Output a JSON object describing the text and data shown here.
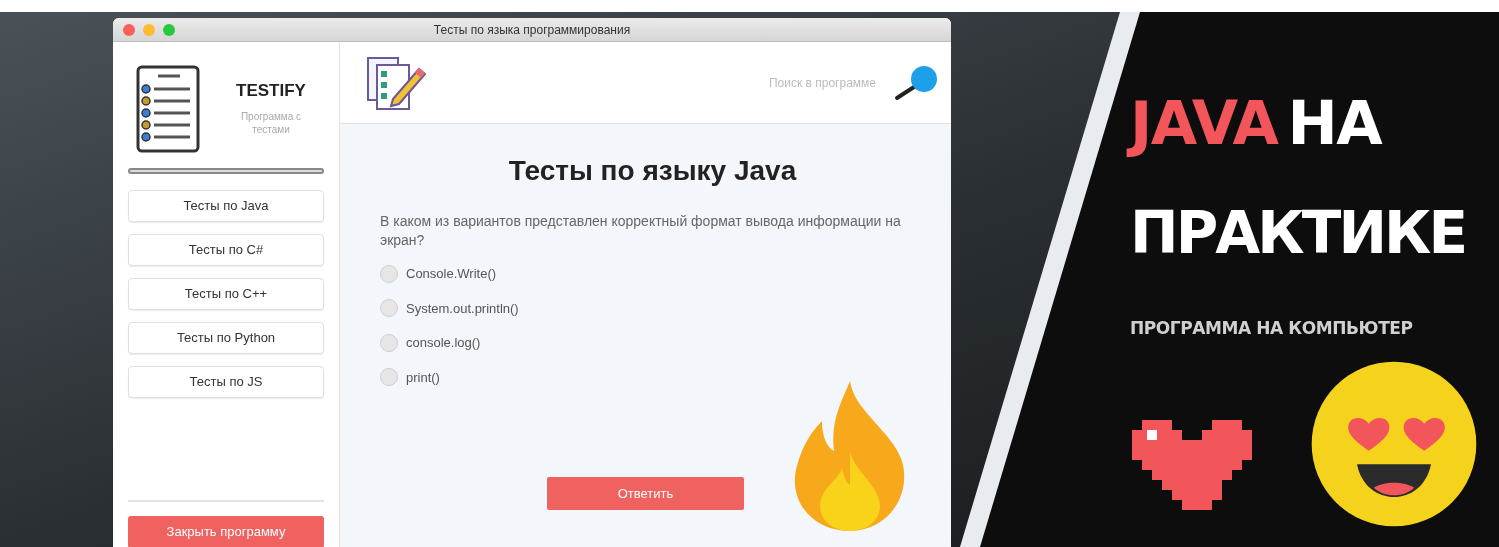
{
  "window": {
    "title": "Тесты по языка программирования"
  },
  "sidebar": {
    "app_name": "TESTIFY",
    "app_subtitle": "Программа с тестами",
    "items": [
      {
        "label": "Тесты по Java"
      },
      {
        "label": "Тесты по C#"
      },
      {
        "label": "Тесты по C++"
      },
      {
        "label": "Тесты по Python"
      },
      {
        "label": "Тесты по JS"
      }
    ],
    "close_button": "Закрыть программу"
  },
  "header": {
    "search": {
      "placeholder": "Поиск в программе"
    }
  },
  "quiz": {
    "heading": "Тесты по языку Java",
    "question": "В каком из вариантов представлен корректный формат вывода информации на экран?",
    "options": [
      {
        "label": "Console.Write()",
        "selected": false
      },
      {
        "label": "System.out.println()",
        "selected": false
      },
      {
        "label": "console.log()",
        "selected": false
      },
      {
        "label": "print()",
        "selected": false
      }
    ],
    "submit_button": "Ответить"
  },
  "banner": {
    "headline": [
      {
        "text": "JAVA",
        "kind": "accent"
      },
      {
        "text": "НА",
        "kind": "plain"
      }
    ],
    "headline_line2": "ПРАКТИКЕ",
    "subtitle": "ПРОГРАММА НА КОМПЬЮТЕР"
  }
}
